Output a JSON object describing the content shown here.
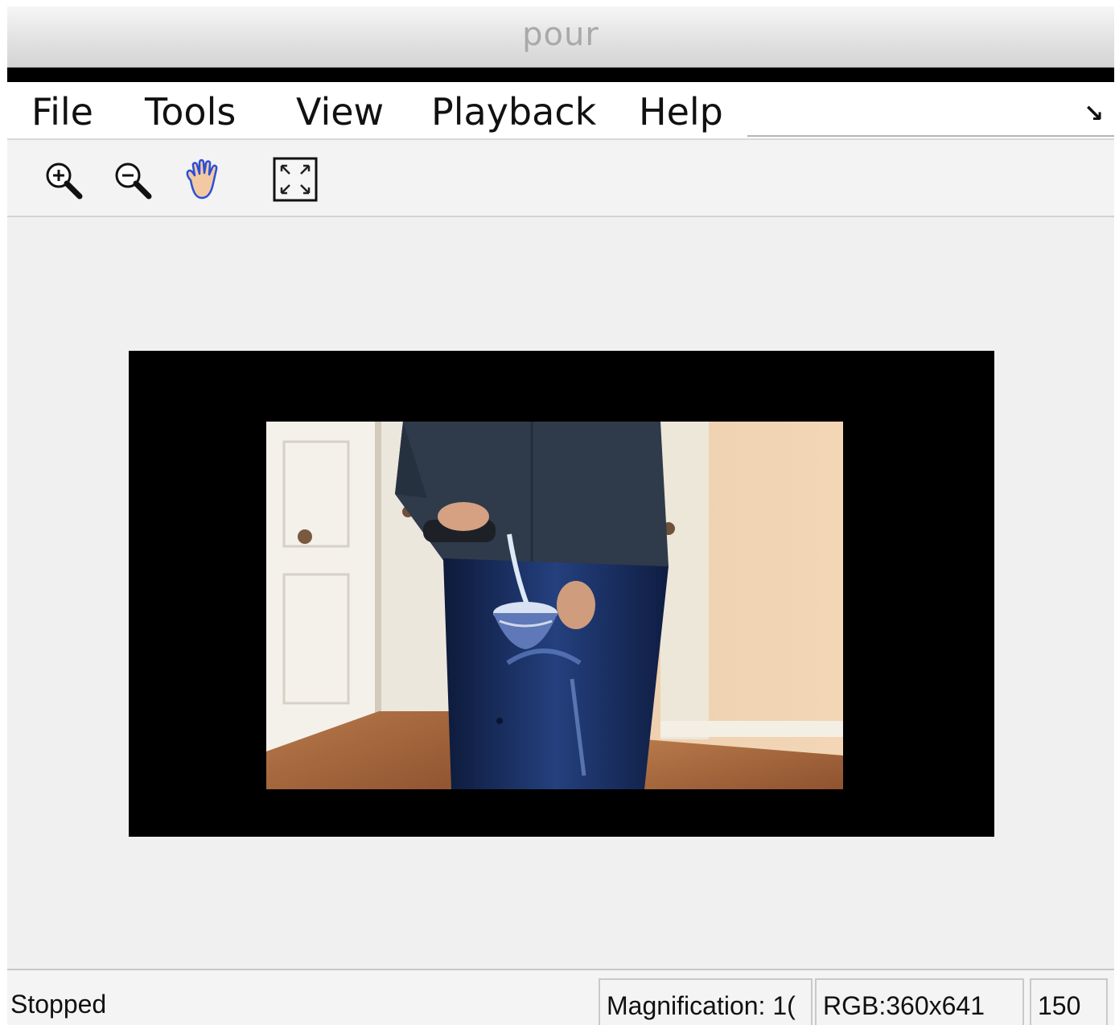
{
  "window": {
    "title": "pour"
  },
  "menu": {
    "items": [
      {
        "label": "File"
      },
      {
        "label": "Tools"
      },
      {
        "label": "View"
      },
      {
        "label": "Playback"
      },
      {
        "label": "Help"
      }
    ]
  },
  "toolbar": {
    "tools": [
      {
        "icon": "zoom-in-icon"
      },
      {
        "icon": "zoom-out-icon"
      },
      {
        "icon": "pan-hand-icon"
      },
      {
        "icon": "fit-to-window-icon"
      }
    ]
  },
  "status": {
    "state": "Stopped",
    "magnification": "Magnification: 1(",
    "image_info": "RGB:360x641",
    "frame": "150"
  }
}
